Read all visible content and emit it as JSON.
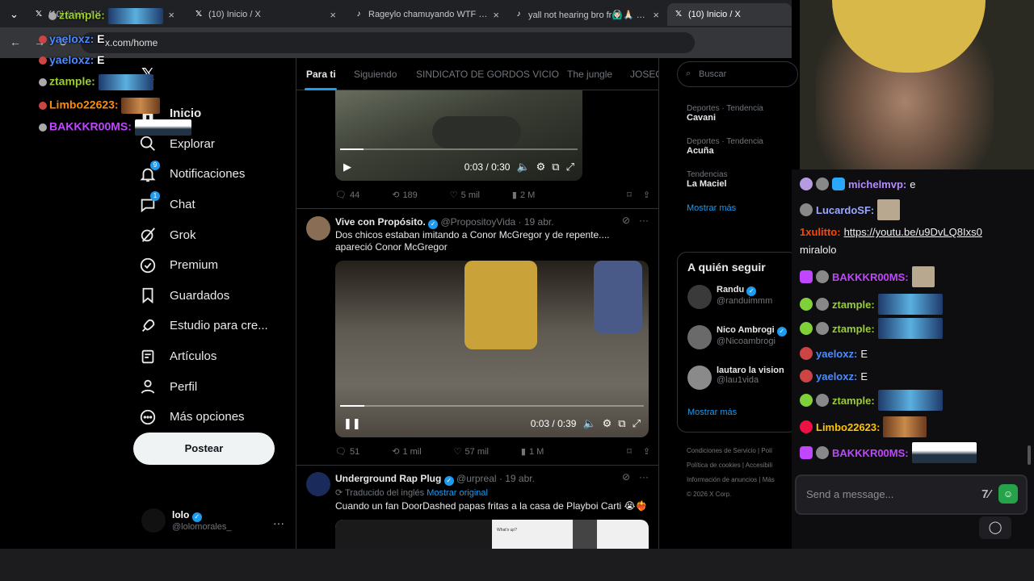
{
  "browser": {
    "tabs": [
      {
        "label": "(10) Inicio / X",
        "favicon": "x-logo-icon"
      },
      {
        "label": "(10) Inicio / X",
        "favicon": "x-logo-icon"
      },
      {
        "label": "Rageylo chamuyando WTF #ra",
        "favicon": "tiktok-icon"
      },
      {
        "label": "yall not hearing bro fr🙆🏻‍♂️🙏🏻 #le",
        "favicon": "tiktok-icon"
      },
      {
        "label": "(10) Inicio / X",
        "favicon": "x-logo-icon"
      }
    ],
    "url": "x.com/home"
  },
  "x_nav": {
    "items": [
      {
        "label": "Inicio",
        "icon": "home-icon",
        "badge": ""
      },
      {
        "label": "Explorar",
        "icon": "search-icon",
        "badge": ""
      },
      {
        "label": "Notificaciones",
        "icon": "bell-icon",
        "badge": "9"
      },
      {
        "label": "Chat",
        "icon": "chat-icon",
        "badge": "1"
      },
      {
        "label": "Grok",
        "icon": "grok-icon",
        "badge": ""
      },
      {
        "label": "Premium",
        "icon": "premium-icon",
        "badge": ""
      },
      {
        "label": "Guardados",
        "icon": "bookmark-icon",
        "badge": ""
      },
      {
        "label": "Estudio para cre...",
        "icon": "rocket-icon",
        "badge": ""
      },
      {
        "label": "Artículos",
        "icon": "article-icon",
        "badge": ""
      },
      {
        "label": "Perfil",
        "icon": "person-icon",
        "badge": ""
      },
      {
        "label": "Más opciones",
        "icon": "more-circle-icon",
        "badge": ""
      }
    ],
    "post_button": "Postear",
    "profile": {
      "name": "lolo",
      "handle": "@lolomorales_"
    }
  },
  "feed": {
    "tabs": [
      "Para ti",
      "Siguiendo",
      "SINDICATO DE GORDOS VICIO",
      "The jungle",
      "JOSEO"
    ],
    "tweet1": {
      "time": "0:03 / 0:30",
      "progress": 0.1,
      "stats": {
        "replies": "44",
        "retweets": "189",
        "likes": "5 mil",
        "views": "2 M"
      }
    },
    "tweet2": {
      "name": "Vive con Propósito.",
      "handle": "@PropositoyVida",
      "date": "· 19 abr.",
      "text": "Dos chicos estaban imitando a Conor McGregor y de repente.... apareció Conor McGregor",
      "time": "0:03 / 0:39",
      "progress": 0.08,
      "stats": {
        "replies": "51",
        "retweets": "1 mil",
        "likes": "57 mil",
        "views": "1 M"
      }
    },
    "tweet3": {
      "name": "Underground Rap Plug",
      "handle": "@urpreal",
      "date": "· 19 abr.",
      "translated": "Traducido del inglés",
      "show_original": "Mostrar original",
      "text": "Cuando un fan DoorDashed papas fritas a la casa de Playboi Carti 😭❤️‍🔥",
      "embedded_label": "What's up?"
    }
  },
  "sidebar": {
    "search_placeholder": "Buscar",
    "trends": [
      {
        "category": "Deportes · Tendencia",
        "title": "Cavani"
      },
      {
        "category": "Deportes · Tendencia",
        "title": "Acuña"
      },
      {
        "category": "Tendencias",
        "title": "La Maciel"
      }
    ],
    "show_more": "Mostrar más",
    "follow_title": "A quién seguir",
    "follow": [
      {
        "name": "Randu",
        "handle": "@randuimmm"
      },
      {
        "name": "Nico Ambrogi",
        "handle": "@Nicoambrogi"
      },
      {
        "name": "lautaro la vision",
        "handle": "@lau1vida"
      }
    ],
    "follow_more": "Mostrar más",
    "footer": [
      "Condiciones de Servicio | Polí",
      "Política de cookies | Accesibili",
      "Información de anuncios | Más",
      "© 2026 X Corp."
    ]
  },
  "overlay_chat": [
    {
      "user": "ztample:",
      "msg": "",
      "color": "#9acd32"
    },
    {
      "user": "yaeloxz:",
      "msg": "E",
      "color": "#4d8cff"
    },
    {
      "user": "yaeloxz:",
      "msg": "E",
      "color": "#4d8cff"
    },
    {
      "user": "ztample:",
      "msg": "",
      "color": "#9acd32"
    },
    {
      "user": "Limbo22623:",
      "msg": "",
      "color": "#ff8c00"
    },
    {
      "user": "BAKKKR00MS:",
      "msg": "",
      "color": "#c046ff"
    }
  ],
  "chat": {
    "messages": [
      {
        "user": "michelmvp:",
        "msg": "e",
        "color": "#b58cff"
      },
      {
        "user": "LucardoSF:",
        "msg": "",
        "color": "#9aa8ff"
      },
      {
        "user": "1xulitto:",
        "msg": "https://youtu.be/u9DvLQ8Ixs0",
        "color": "#ff4500"
      },
      {
        "user": "",
        "msg": "miralolo",
        "color": "#efeff1"
      },
      {
        "user": "BAKKKR00MS:",
        "msg": "",
        "color": "#c046ff"
      },
      {
        "user": "ztample:",
        "msg": "",
        "color": "#9acd32"
      },
      {
        "user": "ztample:",
        "msg": "",
        "color": "#9acd32"
      },
      {
        "user": "yaeloxz:",
        "msg": "E",
        "color": "#4d8cff"
      },
      {
        "user": "yaeloxz:",
        "msg": "E",
        "color": "#4d8cff"
      },
      {
        "user": "ztample:",
        "msg": "",
        "color": "#9acd32"
      },
      {
        "user": "Limbo22623:",
        "msg": "",
        "color": "#ffc400"
      },
      {
        "user": "BAKKKR00MS:",
        "msg": "",
        "color": "#c046ff"
      }
    ],
    "placeholder": "Send a message..."
  },
  "colors": {
    "accent": "#1d9bf0",
    "bg": "#000000",
    "chat_bg": "#0e0e10"
  }
}
